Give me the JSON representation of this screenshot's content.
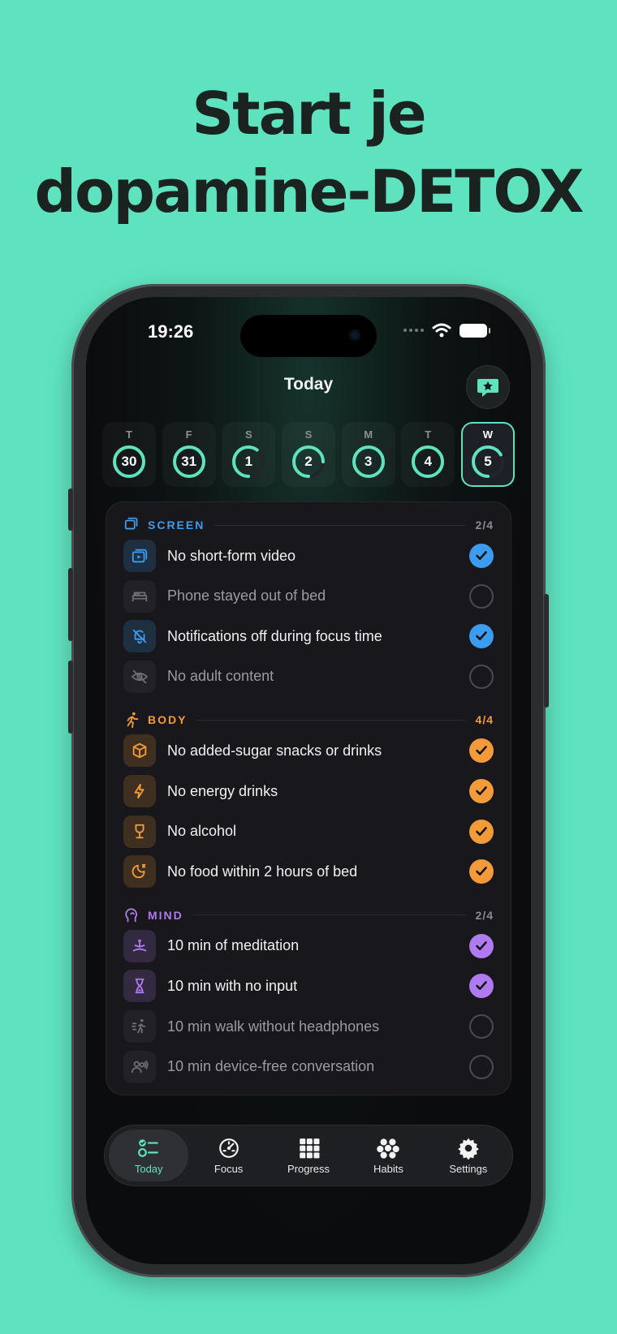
{
  "headline": {
    "line1": "Start je",
    "line2": "dopamine-DETOX"
  },
  "status_bar": {
    "time": "19:26"
  },
  "nav": {
    "title": "Today",
    "chat_icon": "chat-star-icon"
  },
  "colors": {
    "background": "#5fe3bf",
    "accent": "#5fe3bf",
    "screen": "#3b9cf0",
    "body": "#f39a3b",
    "mind": "#b07af0"
  },
  "days": [
    {
      "letter": "T",
      "number": "30",
      "progress": 1.0,
      "active": false
    },
    {
      "letter": "F",
      "number": "31",
      "progress": 1.0,
      "active": false
    },
    {
      "letter": "S",
      "number": "1",
      "progress": 0.6,
      "active": false
    },
    {
      "letter": "S",
      "number": "2",
      "progress": 0.75,
      "active": false
    },
    {
      "letter": "M",
      "number": "3",
      "progress": 1.0,
      "active": false
    },
    {
      "letter": "T",
      "number": "4",
      "progress": 1.0,
      "active": false
    },
    {
      "letter": "W",
      "number": "5",
      "progress": 0.67,
      "active": true
    }
  ],
  "sections": [
    {
      "title": "SCREEN",
      "count": "2/4",
      "color": "#3b9cf0",
      "icon": "screens-icon",
      "items": [
        {
          "label": "No short-form video",
          "done": true,
          "icon": "video-stack-icon"
        },
        {
          "label": "Phone stayed out of bed",
          "done": false,
          "icon": "bed-icon"
        },
        {
          "label": "Notifications off during focus time",
          "done": true,
          "icon": "bell-off-icon"
        },
        {
          "label": "No adult content",
          "done": false,
          "icon": "eye-off-icon"
        }
      ]
    },
    {
      "title": "BODY",
      "count": "4/4",
      "color": "#f39a3b",
      "icon": "running-icon",
      "items": [
        {
          "label": "No added-sugar snacks or drinks",
          "done": true,
          "icon": "cube-icon"
        },
        {
          "label": "No energy drinks",
          "done": true,
          "icon": "bolt-icon"
        },
        {
          "label": "No alcohol",
          "done": true,
          "icon": "wine-glass-icon"
        },
        {
          "label": "No food within 2 hours of bed",
          "done": true,
          "icon": "moon-sleep-icon"
        }
      ]
    },
    {
      "title": "MIND",
      "count": "2/4",
      "color": "#b07af0",
      "icon": "head-icon",
      "items": [
        {
          "label": "10 min of meditation",
          "done": true,
          "icon": "meditation-icon"
        },
        {
          "label": "10 min with no input",
          "done": true,
          "icon": "hourglass-icon"
        },
        {
          "label": "10 min walk without headphones",
          "done": false,
          "icon": "walking-icon"
        },
        {
          "label": "10 min device-free conversation",
          "done": false,
          "icon": "people-talking-icon"
        }
      ]
    }
  ],
  "tabs": [
    {
      "label": "Today",
      "icon": "checklist-icon",
      "active": true
    },
    {
      "label": "Focus",
      "icon": "gauge-icon",
      "active": false
    },
    {
      "label": "Progress",
      "icon": "grid-icon",
      "active": false
    },
    {
      "label": "Habits",
      "icon": "dots-cluster-icon",
      "active": false
    },
    {
      "label": "Settings",
      "icon": "gear-icon",
      "active": false
    }
  ]
}
